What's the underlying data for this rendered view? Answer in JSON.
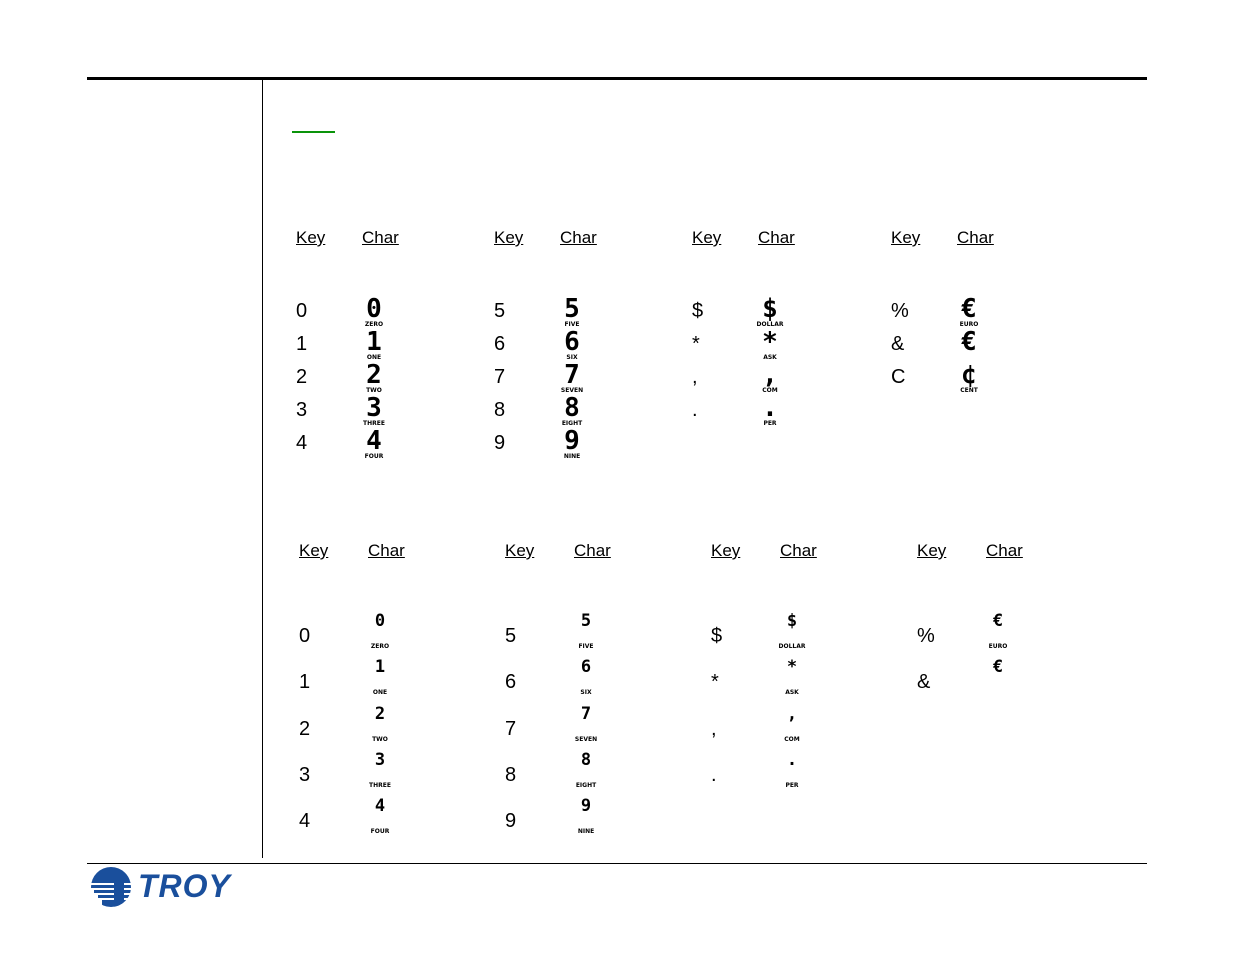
{
  "brand": {
    "name": "TROY",
    "color": "#1a4f9c",
    "link_color": "#0a930a"
  },
  "header_labels": {
    "key": "Key",
    "char": "Char"
  },
  "top_tables": [
    {
      "rows": [
        {
          "key": "0",
          "glyph": "0",
          "caption": "ZERO"
        },
        {
          "key": "1",
          "glyph": "1",
          "caption": "ONE"
        },
        {
          "key": "2",
          "glyph": "2",
          "caption": "TWO"
        },
        {
          "key": "3",
          "glyph": "3",
          "caption": "THREE"
        },
        {
          "key": "4",
          "glyph": "4",
          "caption": "FOUR"
        }
      ]
    },
    {
      "rows": [
        {
          "key": "5",
          "glyph": "5",
          "caption": "FIVE"
        },
        {
          "key": "6",
          "glyph": "6",
          "caption": "SIX"
        },
        {
          "key": "7",
          "glyph": "7",
          "caption": "SEVEN"
        },
        {
          "key": "8",
          "glyph": "8",
          "caption": "EIGHT"
        },
        {
          "key": "9",
          "glyph": "9",
          "caption": "NINE"
        }
      ]
    },
    {
      "rows": [
        {
          "key": "$",
          "glyph": "$",
          "caption": "DOLLAR"
        },
        {
          "key": "*",
          "glyph": "*",
          "caption": "ASK"
        },
        {
          "key": ",",
          "glyph": ",",
          "caption": "COM"
        },
        {
          "key": ".",
          "glyph": ".",
          "caption": "PER"
        }
      ]
    },
    {
      "rows": [
        {
          "key": "%",
          "glyph": "€",
          "caption": "EURO"
        },
        {
          "key": "&",
          "glyph": "€",
          "caption": ""
        },
        {
          "key": "C",
          "glyph": "¢",
          "caption": "CENT"
        }
      ]
    }
  ],
  "bottom_tables": [
    {
      "rows": [
        {
          "key": "0",
          "glyph": "0",
          "caption": "ZERO"
        },
        {
          "key": "1",
          "glyph": "1",
          "caption": "ONE"
        },
        {
          "key": "2",
          "glyph": "2",
          "caption": "TWO"
        },
        {
          "key": "3",
          "glyph": "3",
          "caption": "THREE"
        },
        {
          "key": "4",
          "glyph": "4",
          "caption": "FOUR"
        }
      ]
    },
    {
      "rows": [
        {
          "key": "5",
          "glyph": "5",
          "caption": "FIVE"
        },
        {
          "key": "6",
          "glyph": "6",
          "caption": "SIX"
        },
        {
          "key": "7",
          "glyph": "7",
          "caption": "SEVEN"
        },
        {
          "key": "8",
          "glyph": "8",
          "caption": "EIGHT"
        },
        {
          "key": "9",
          "glyph": "9",
          "caption": "NINE"
        }
      ]
    },
    {
      "rows": [
        {
          "key": "$",
          "glyph": "$",
          "caption": "DOLLAR"
        },
        {
          "key": "*",
          "glyph": "*",
          "caption": "ASK"
        },
        {
          "key": ",",
          "glyph": ",",
          "caption": "COM"
        },
        {
          "key": ".",
          "glyph": ".",
          "caption": "PER"
        }
      ]
    },
    {
      "rows": [
        {
          "key": "%",
          "glyph": "€",
          "caption": "EURO"
        },
        {
          "key": "&",
          "glyph": "€",
          "caption": ""
        }
      ]
    }
  ]
}
